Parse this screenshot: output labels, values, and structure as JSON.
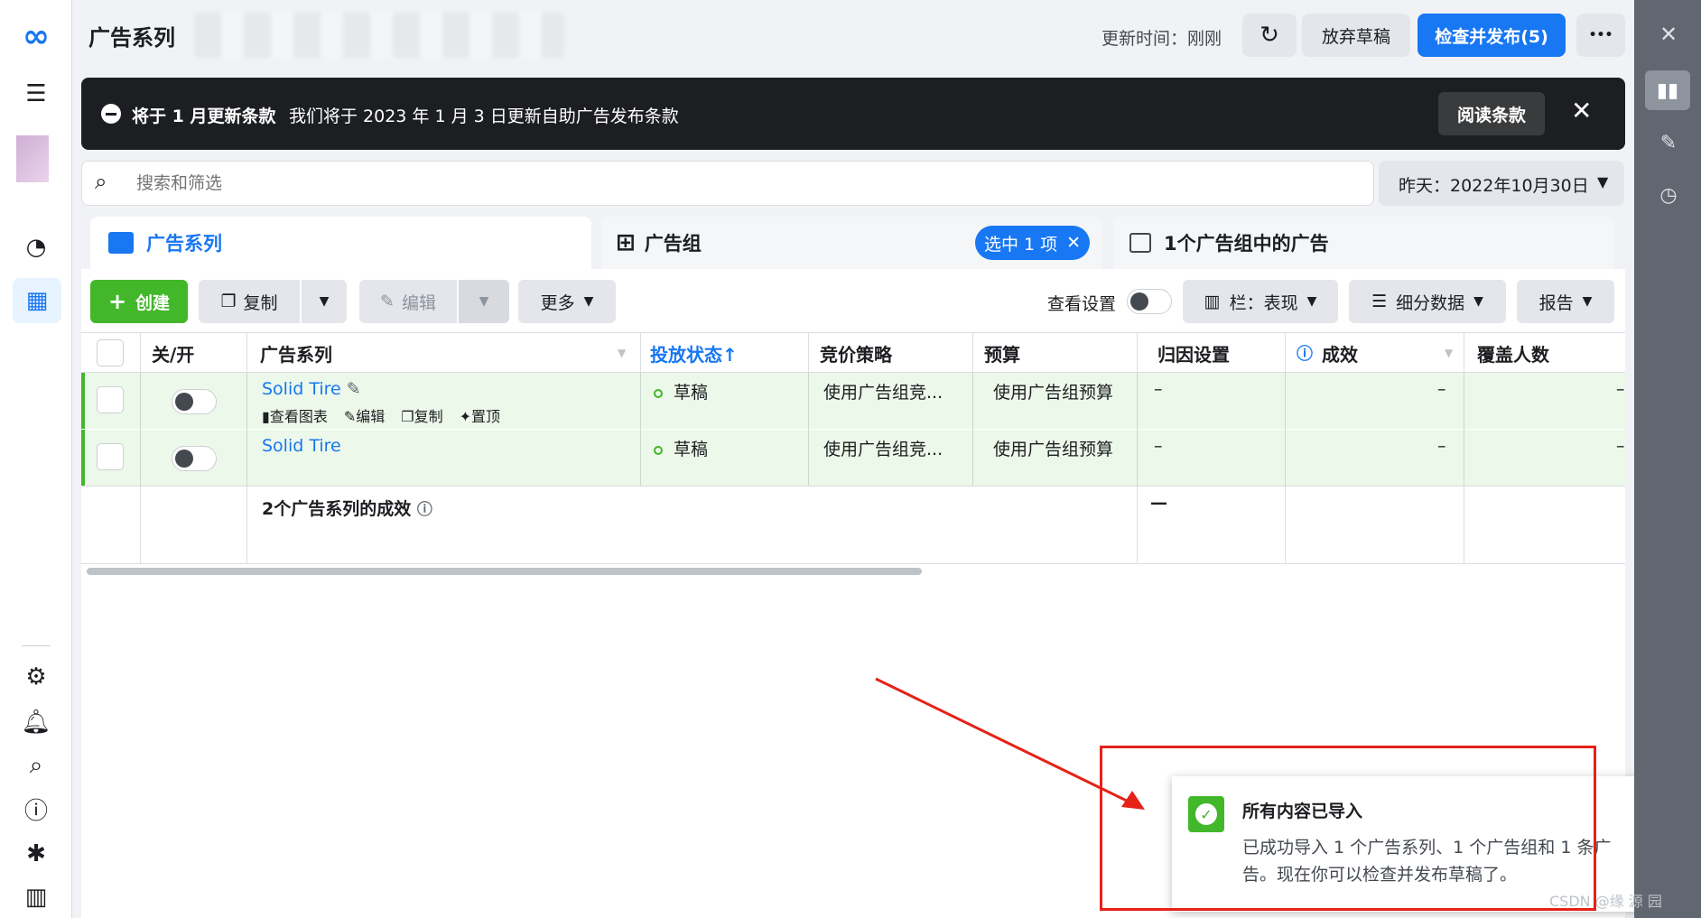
{
  "header": {
    "title": "广告系列",
    "updated_label": "更新时间：刚刚",
    "discard_label": "放弃草稿",
    "publish_label": "检查并发布(5)",
    "more_label": "•••"
  },
  "banner": {
    "title": "将于 1 月更新条款",
    "message": "我们将于 2023 年 1 月 3 日更新自助广告发布条款",
    "read_label": "阅读条款"
  },
  "search": {
    "placeholder": "搜索和筛选"
  },
  "date_picker": {
    "label": "昨天：2022年10月30日"
  },
  "tabs": [
    {
      "label": "广告系列"
    },
    {
      "label": "广告组",
      "badge": "选中 1 项"
    },
    {
      "label": "1个广告组中的广告"
    }
  ],
  "toolbar": {
    "create": "创建",
    "copy": "复制",
    "edit": "编辑",
    "more": "更多",
    "view_settings": "查看设置",
    "columns": "栏：表现",
    "breakdown": "细分数据",
    "report": "报告"
  },
  "table": {
    "headers": [
      "关/开",
      "广告系列",
      "投放状态↑",
      "竞价策略",
      "预算",
      "归因设置",
      "成效",
      "覆盖人数"
    ],
    "rows": [
      {
        "name": "Solid Tire",
        "status": "草稿",
        "bid": "使用广告组竞...",
        "budget": "使用广告组预算",
        "attribution": "–",
        "results": "–",
        "reach": "–",
        "actions": [
          "查看图表",
          "编辑",
          "复制",
          "置顶"
        ]
      },
      {
        "name": "Solid Tire",
        "status": "草稿",
        "bid": "使用广告组竞...",
        "budget": "使用广告组预算",
        "attribution": "–",
        "results": "–",
        "reach": "–"
      }
    ],
    "summary_label": "2个广告系列的成效",
    "summary_attribution": "—"
  },
  "toast": {
    "title": "所有内容已导入",
    "line1": "已成功导入 1 个广告系列、1 个广告组和 1 条广",
    "line2": "告。现在你可以检查并发布草稿了。"
  },
  "watermark": "CSDN @缘 源 园",
  "colors": {
    "accent": "#1877f2",
    "success": "#42b72a",
    "annotation": "#e62117"
  }
}
